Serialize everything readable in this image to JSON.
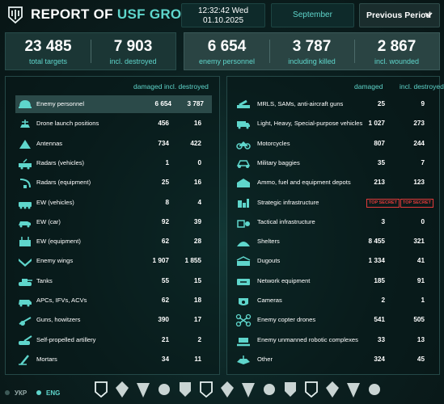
{
  "header": {
    "title_main": "REPORT OF ",
    "title_accent": "USF GROUPING",
    "time": "12:32:42 Wed",
    "date": "01.10.2025",
    "month": "September",
    "period_label": "Previous Period"
  },
  "stats_left": [
    {
      "value": "23 485",
      "label": "total targets"
    },
    {
      "value": "7 903",
      "label": "incl. destroyed"
    }
  ],
  "stats_right": [
    {
      "value": "6 654",
      "label": "enemy personnel"
    },
    {
      "value": "3 787",
      "label": "including killed"
    },
    {
      "value": "2 867",
      "label": "incl. wounded"
    }
  ],
  "columns": {
    "damaged": "damaged",
    "destroyed": "incl. destroyed"
  },
  "left_rows": [
    {
      "icon": "helmet-icon",
      "name": "Enemy personnel",
      "damaged": "6 654",
      "destroyed": "3 787",
      "highlight": true
    },
    {
      "icon": "drone-launch-icon",
      "name": "Drone launch positions",
      "damaged": "456",
      "destroyed": "16"
    },
    {
      "icon": "antenna-icon",
      "name": "Antennas",
      "damaged": "734",
      "destroyed": "422"
    },
    {
      "icon": "radar-vehicle-icon",
      "name": "Radars (vehicles)",
      "damaged": "1",
      "destroyed": "0"
    },
    {
      "icon": "radar-equipment-icon",
      "name": "Radars (equipment)",
      "damaged": "25",
      "destroyed": "16"
    },
    {
      "icon": "ew-vehicle-icon",
      "name": "EW (vehicles)",
      "damaged": "8",
      "destroyed": "4"
    },
    {
      "icon": "ew-car-icon",
      "name": "EW (car)",
      "damaged": "92",
      "destroyed": "39"
    },
    {
      "icon": "ew-equipment-icon",
      "name": "EW (equipment)",
      "damaged": "62",
      "destroyed": "28"
    },
    {
      "icon": "wings-icon",
      "name": "Enemy wings",
      "damaged": "1 907",
      "destroyed": "1 855"
    },
    {
      "icon": "tank-icon",
      "name": "Tanks",
      "damaged": "55",
      "destroyed": "15"
    },
    {
      "icon": "apc-icon",
      "name": "APCs, IFVs, ACVs",
      "damaged": "62",
      "destroyed": "18"
    },
    {
      "icon": "howitzer-icon",
      "name": "Guns, howitzers",
      "damaged": "390",
      "destroyed": "17"
    },
    {
      "icon": "spa-icon",
      "name": "Self-propelled artillery",
      "damaged": "21",
      "destroyed": "2"
    },
    {
      "icon": "mortar-icon",
      "name": "Mortars",
      "damaged": "34",
      "destroyed": "11"
    }
  ],
  "right_rows": [
    {
      "icon": "mlrs-icon",
      "name": "MRLS, SAMs, anti-aircraft guns",
      "damaged": "25",
      "destroyed": "9"
    },
    {
      "icon": "truck-icon",
      "name": "Light, Heavy, Special-purpose vehicles",
      "damaged": "1 027",
      "destroyed": "273"
    },
    {
      "icon": "motorcycle-icon",
      "name": "Motorcycles",
      "damaged": "807",
      "destroyed": "244"
    },
    {
      "icon": "buggy-icon",
      "name": "Military baggies",
      "damaged": "35",
      "destroyed": "7"
    },
    {
      "icon": "depot-icon",
      "name": "Ammo, fuel and equipment depots",
      "damaged": "213",
      "destroyed": "123"
    },
    {
      "icon": "strategic-infrastructure-icon",
      "name": "Strategic infrastructure",
      "damaged": "TOP SECRET",
      "destroyed": "TOP SECRET",
      "secret": true
    },
    {
      "icon": "tactical-infrastructure-icon",
      "name": "Tactical infrastructure",
      "damaged": "3",
      "destroyed": "0"
    },
    {
      "icon": "shelter-icon",
      "name": "Shelters",
      "damaged": "8 455",
      "destroyed": "321"
    },
    {
      "icon": "dugout-icon",
      "name": "Dugouts",
      "damaged": "1 334",
      "destroyed": "41"
    },
    {
      "icon": "network-icon",
      "name": "Network equipment",
      "damaged": "185",
      "destroyed": "91"
    },
    {
      "icon": "camera-icon",
      "name": "Cameras",
      "damaged": "2",
      "destroyed": "1"
    },
    {
      "icon": "copter-drone-icon",
      "name": "Enemy copter drones",
      "damaged": "541",
      "destroyed": "505"
    },
    {
      "icon": "robot-complex-icon",
      "name": "Enemy unmanned robotic complexes",
      "damaged": "33",
      "destroyed": "13"
    },
    {
      "icon": "other-icon",
      "name": "Other",
      "damaged": "324",
      "destroyed": "45"
    }
  ],
  "footer": {
    "lang_ukr": "УКР",
    "lang_eng": "ENG",
    "emblems": [
      "usf-emblem-icon",
      "unit-emblem-1-icon",
      "unit-emblem-2-icon",
      "unit-emblem-3-icon",
      "unit-emblem-4-icon",
      "unit-emblem-5-icon",
      "unit-emblem-6-icon",
      "unit-emblem-7-icon",
      "unit-emblem-8-icon",
      "unit-emblem-9-icon",
      "unit-emblem-10-icon",
      "unit-emblem-11-icon",
      "unit-emblem-12-icon",
      "unit-emblem-13-icon"
    ]
  },
  "colors": {
    "accent": "#5fd6cc",
    "secret": "#e23a3a",
    "background": "#0b1f1f"
  }
}
